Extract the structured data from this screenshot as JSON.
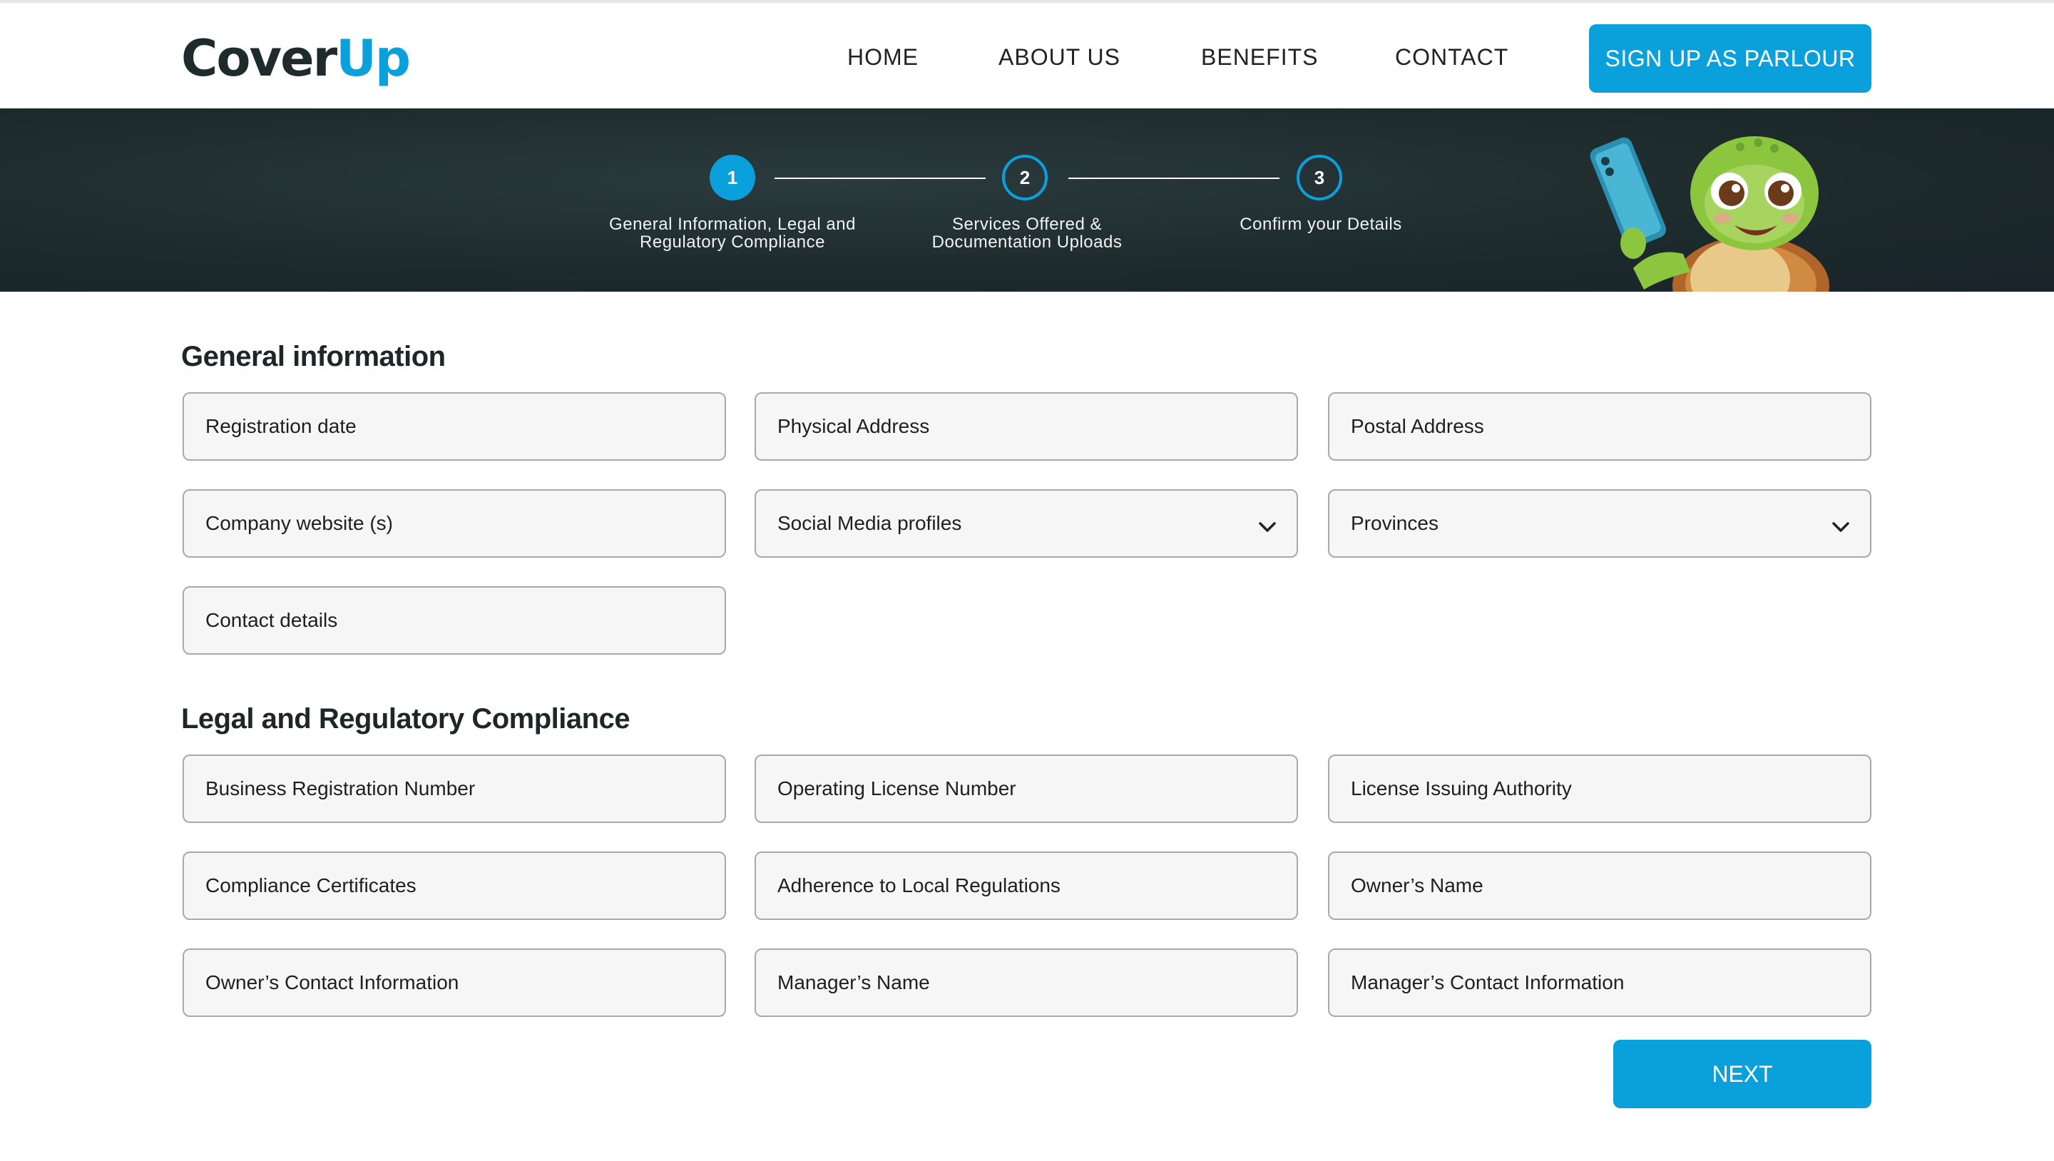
{
  "brand": {
    "logo_part1": "Cover",
    "logo_part2": "Up",
    "accent": "#0aa0dc",
    "dark": "#1e2a2c"
  },
  "nav": {
    "items": [
      {
        "label": "HOME"
      },
      {
        "label": "ABOUT US"
      },
      {
        "label": "BENEFITS"
      },
      {
        "label": "CONTACT"
      }
    ],
    "signup_label": "SIGN UP AS PARLOUR"
  },
  "stepper": {
    "current": 1,
    "steps": [
      {
        "number": "1",
        "line1": "General Information, Legal and",
        "line2": "Regulatory Compliance"
      },
      {
        "number": "2",
        "line1": "Services Offered &",
        "line2": "Documentation Uploads"
      },
      {
        "number": "3",
        "line1": "Confirm your Details",
        "line2": ""
      }
    ]
  },
  "general": {
    "title": "General information",
    "fields": [
      {
        "placeholder": "Registration date"
      },
      {
        "placeholder": "Physical Address"
      },
      {
        "placeholder": "Postal Address"
      },
      {
        "placeholder": "Company website (s)"
      },
      {
        "placeholder": "Social Media profiles",
        "dropdown": true
      },
      {
        "placeholder": "Provinces",
        "dropdown": true
      },
      {
        "placeholder": "Contact details"
      }
    ]
  },
  "legal": {
    "title": "Legal and Regulatory Compliance",
    "fields": [
      {
        "placeholder": "Business Registration Number"
      },
      {
        "placeholder": "Operating License Number"
      },
      {
        "placeholder": "License Issuing Authority"
      },
      {
        "placeholder": "Compliance Certificates"
      },
      {
        "placeholder": "Adherence to Local Regulations"
      },
      {
        "placeholder": "Owner’s Name"
      },
      {
        "placeholder": "Owner’s Contact Information"
      },
      {
        "placeholder": "Manager’s Name"
      },
      {
        "placeholder": "Manager’s Contact Information"
      }
    ]
  },
  "actions": {
    "next_label": "NEXT"
  },
  "icons": {
    "mascot": "turtle-mascot-with-phone",
    "dropdown": "chevron-down-icon"
  }
}
